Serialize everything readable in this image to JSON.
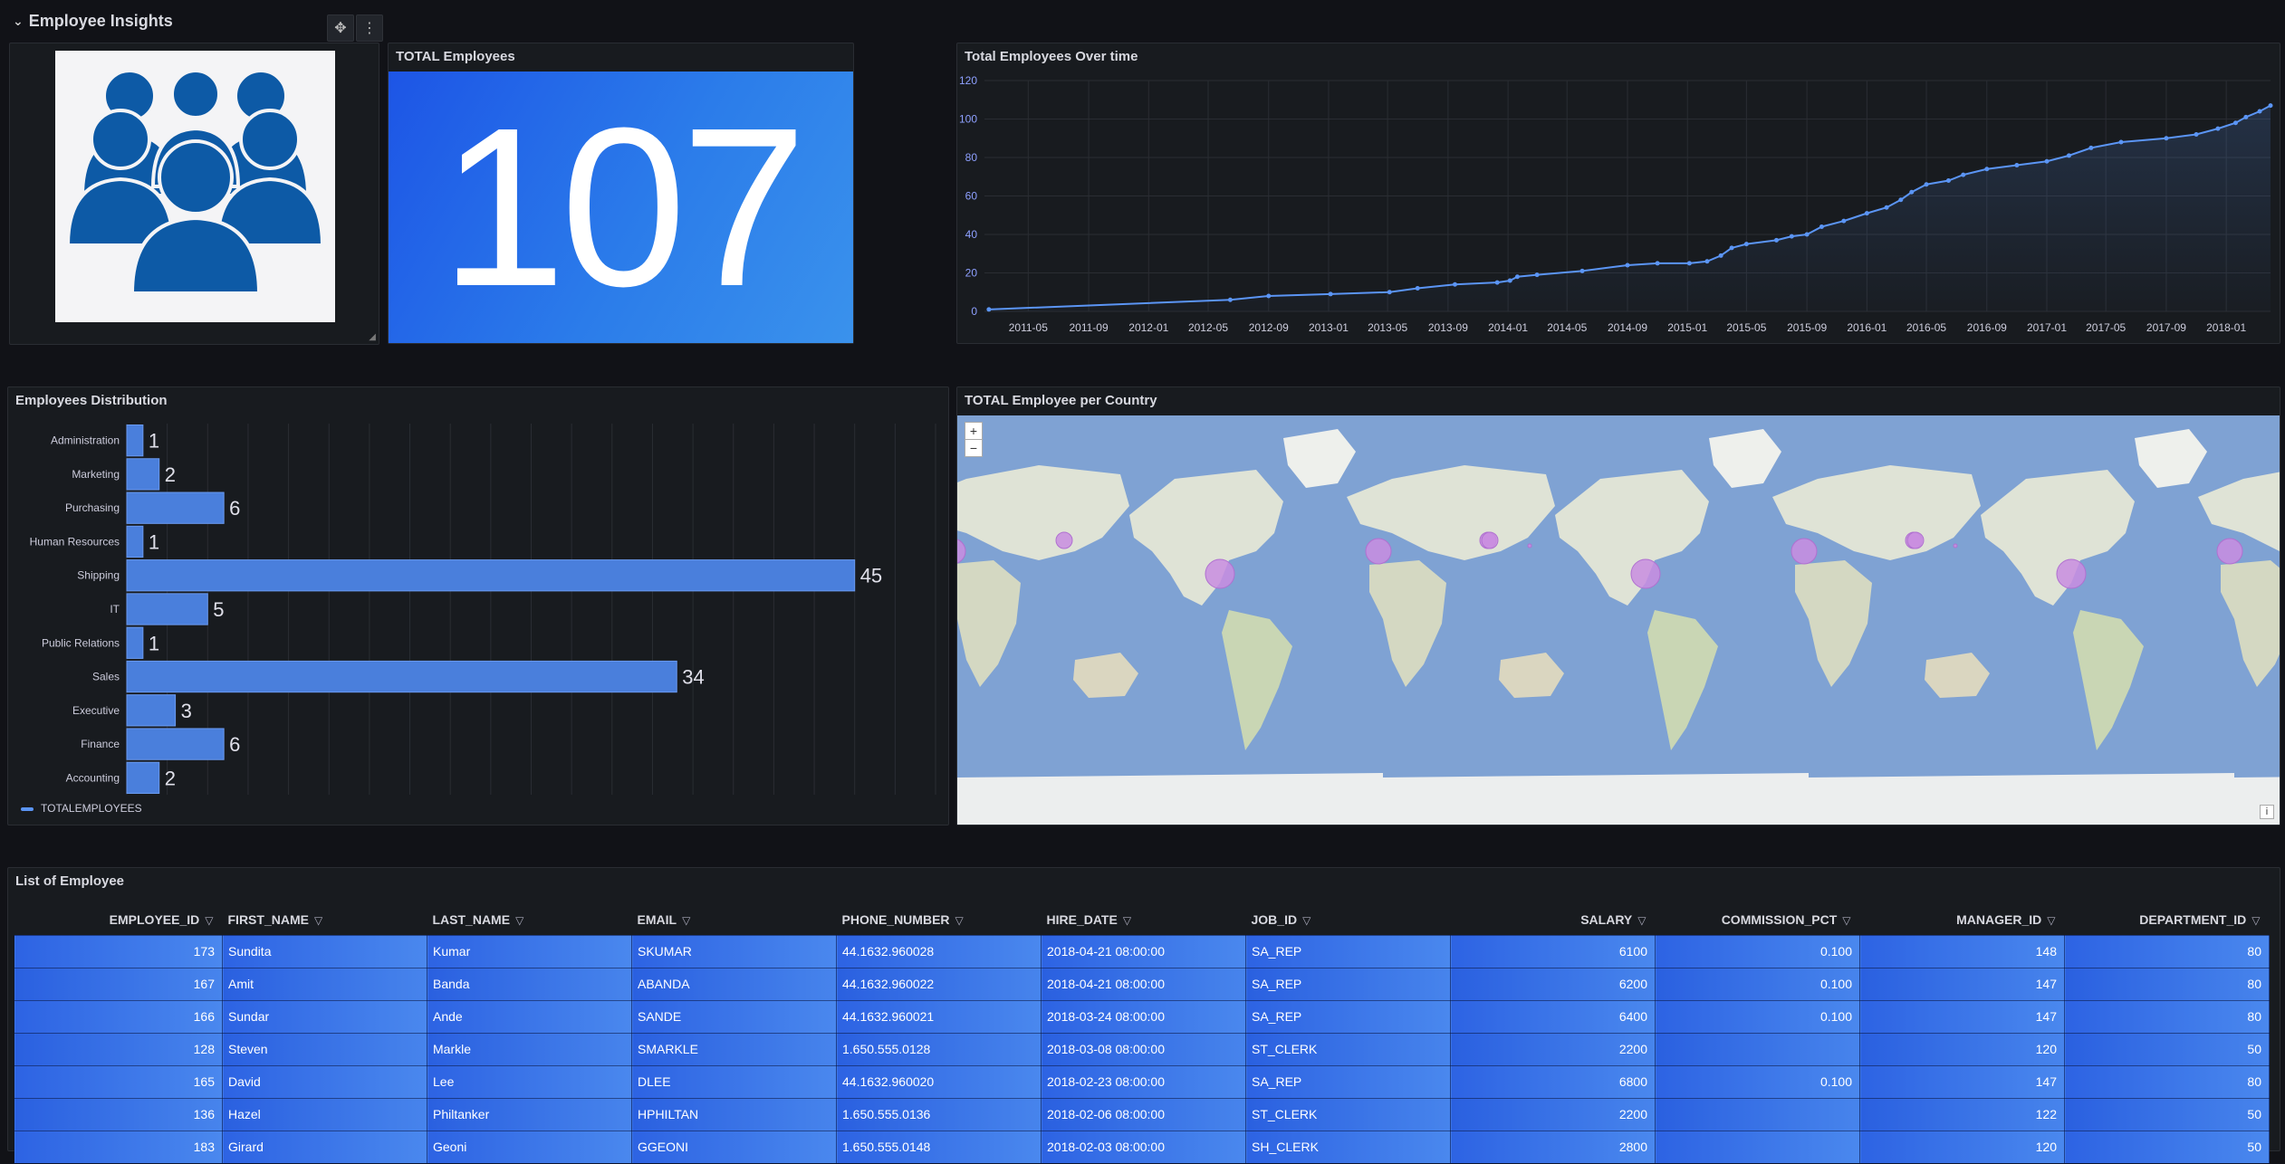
{
  "row": {
    "title": "Employee Insights",
    "chevron_icon": "chevron-down-icon"
  },
  "panel_toolbar": {
    "move_icon": "move-icon",
    "menu_icon": "kebab-menu-icon"
  },
  "logo_panel": {
    "icon": "people-group-icon",
    "color": "#0d5aa6"
  },
  "stat_panel": {
    "title": "TOTAL Employees",
    "value": "107"
  },
  "timeseries_panel": {
    "title": "Total Employees Over time",
    "chart_data": {
      "type": "line",
      "y_ticks": [
        "120",
        "100",
        "80",
        "60",
        "40",
        "20",
        "0"
      ],
      "ylim": [
        0,
        120
      ],
      "x_ticks": [
        "2011-05",
        "2011-09",
        "2012-01",
        "2012-05",
        "2012-09",
        "2013-01",
        "2013-05",
        "2013-09",
        "2014-01",
        "2014-05",
        "2014-09",
        "2015-01",
        "2015-05",
        "2015-09",
        "2016-01",
        "2016-05",
        "2016-09",
        "2017-01",
        "2017-05",
        "2017-09",
        "2018-01"
      ],
      "xlim": [
        "2011-02",
        "2018-04"
      ],
      "grid": true,
      "line_color": "#5b95f5",
      "points": [
        [
          "2011-02-10",
          1
        ],
        [
          "2012-06-15",
          6
        ],
        [
          "2012-09-01",
          8
        ],
        [
          "2013-01-05",
          9
        ],
        [
          "2013-05-05",
          10
        ],
        [
          "2013-07-01",
          12
        ],
        [
          "2013-09-15",
          14
        ],
        [
          "2013-12-10",
          15
        ],
        [
          "2014-01-05",
          16
        ],
        [
          "2014-01-20",
          18
        ],
        [
          "2014-03-01",
          19
        ],
        [
          "2014-06-01",
          21
        ],
        [
          "2014-09-01",
          24
        ],
        [
          "2014-11-01",
          25
        ],
        [
          "2015-01-05",
          25
        ],
        [
          "2015-02-10",
          26
        ],
        [
          "2015-03-10",
          29
        ],
        [
          "2015-04-01",
          33
        ],
        [
          "2015-05-01",
          35
        ],
        [
          "2015-07-01",
          37
        ],
        [
          "2015-08-01",
          39
        ],
        [
          "2015-09-01",
          40
        ],
        [
          "2015-10-01",
          44
        ],
        [
          "2015-11-15",
          47
        ],
        [
          "2016-01-01",
          51
        ],
        [
          "2016-02-10",
          54
        ],
        [
          "2016-03-10",
          58
        ],
        [
          "2016-04-01",
          62
        ],
        [
          "2016-05-01",
          66
        ],
        [
          "2016-06-15",
          68
        ],
        [
          "2016-07-15",
          71
        ],
        [
          "2016-09-01",
          74
        ],
        [
          "2016-11-01",
          76
        ],
        [
          "2017-01-01",
          78
        ],
        [
          "2017-02-15",
          81
        ],
        [
          "2017-04-01",
          85
        ],
        [
          "2017-06-01",
          88
        ],
        [
          "2017-09-01",
          90
        ],
        [
          "2017-11-01",
          92
        ],
        [
          "2017-12-15",
          95
        ],
        [
          "2018-01-20",
          98
        ],
        [
          "2018-02-10",
          101
        ],
        [
          "2018-03-10",
          104
        ],
        [
          "2018-04-01",
          107
        ]
      ]
    }
  },
  "bar_panel": {
    "title": "Employees Distribution",
    "legend": "TOTALEMPLOYEES",
    "chart_data": {
      "type": "bar",
      "orientation": "horizontal",
      "categories": [
        "Administration",
        "Marketing",
        "Purchasing",
        "Human Resources",
        "Shipping",
        "IT",
        "Public Relations",
        "Sales",
        "Executive",
        "Finance",
        "Accounting"
      ],
      "series": [
        {
          "name": "TOTALEMPLOYEES",
          "values": [
            1,
            2,
            6,
            1,
            45,
            5,
            1,
            34,
            3,
            6,
            2
          ]
        }
      ],
      "x_ticks": [
        "0",
        "2.5",
        "5",
        "7.5",
        "10",
        "12.5",
        "15",
        "17.5",
        "20",
        "22.5",
        "25",
        "27.5",
        "30",
        "32.5",
        "35",
        "37.5",
        "40",
        "42.5",
        "45",
        "47.5",
        "50"
      ],
      "xlim": [
        0,
        50
      ],
      "grid": true,
      "legend_placement": "bottom-left",
      "bar_color": "#4a7fdc"
    }
  },
  "map_panel": {
    "title": "TOTAL Employee per Country",
    "zoom_in": "+",
    "zoom_out": "−",
    "info": "i",
    "bubble_color": "#c98de0"
  },
  "table_panel": {
    "title": "List of Employee",
    "filter_icon": "filter-icon",
    "columns": [
      "EMPLOYEE_ID",
      "FIRST_NAME",
      "LAST_NAME",
      "EMAIL",
      "PHONE_NUMBER",
      "HIRE_DATE",
      "JOB_ID",
      "SALARY",
      "COMMISSION_PCT",
      "MANAGER_ID",
      "DEPARTMENT_ID"
    ],
    "rows": [
      [
        "173",
        "Sundita",
        "Kumar",
        "SKUMAR",
        "44.1632.960028",
        "2018-04-21 08:00:00",
        "SA_REP",
        "6100",
        "0.100",
        "148",
        "80"
      ],
      [
        "167",
        "Amit",
        "Banda",
        "ABANDA",
        "44.1632.960022",
        "2018-04-21 08:00:00",
        "SA_REP",
        "6200",
        "0.100",
        "147",
        "80"
      ],
      [
        "166",
        "Sundar",
        "Ande",
        "SANDE",
        "44.1632.960021",
        "2018-03-24 08:00:00",
        "SA_REP",
        "6400",
        "0.100",
        "147",
        "80"
      ],
      [
        "128",
        "Steven",
        "Markle",
        "SMARKLE",
        "1.650.555.0128",
        "2018-03-08 08:00:00",
        "ST_CLERK",
        "2200",
        "",
        "120",
        "50"
      ],
      [
        "165",
        "David",
        "Lee",
        "DLEE",
        "44.1632.960020",
        "2018-02-23 08:00:00",
        "SA_REP",
        "6800",
        "0.100",
        "147",
        "80"
      ],
      [
        "136",
        "Hazel",
        "Philtanker",
        "HPHILTAN",
        "1.650.555.0136",
        "2018-02-06 08:00:00",
        "ST_CLERK",
        "2200",
        "",
        "122",
        "50"
      ],
      [
        "183",
        "Girard",
        "Geoni",
        "GGEONI",
        "1.650.555.0148",
        "2018-02-03 08:00:00",
        "SH_CLERK",
        "2800",
        "",
        "120",
        "50"
      ]
    ]
  }
}
